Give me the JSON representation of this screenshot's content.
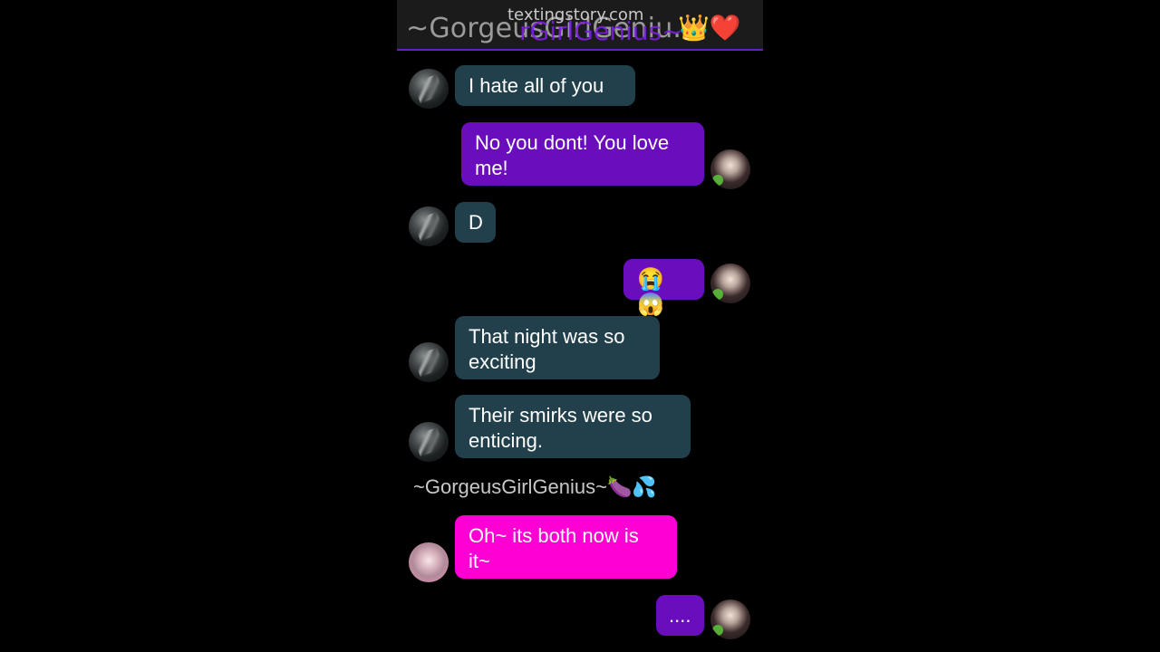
{
  "header": {
    "title": "~GorgeusGirlGeniu...",
    "overlay_text": "rGirlGenius~",
    "emoji": "👑❤️",
    "watermark": "textingstory.com"
  },
  "messages": [
    {
      "side": "in",
      "text": "I hate all of you"
    },
    {
      "side": "out",
      "text": "No you dont! You love me!"
    },
    {
      "side": "in",
      "text": "D"
    },
    {
      "side": "out",
      "text": "😭😱"
    },
    {
      "side": "in",
      "text": "That night was so exciting"
    },
    {
      "side": "in",
      "text": "Their smirks were so enticing."
    },
    {
      "side": "label",
      "text": "~GorgeusGirlGenius~🍆💦"
    },
    {
      "side": "in-pink",
      "text": "Oh~ its both now is it~"
    },
    {
      "side": "out",
      "text": "...."
    }
  ],
  "colors": {
    "incoming_bubble": "#22404c",
    "outgoing_bubble": "#6a0dbd",
    "pink_bubble": "#ff00d4",
    "header_accent": "#6a1fc2"
  }
}
